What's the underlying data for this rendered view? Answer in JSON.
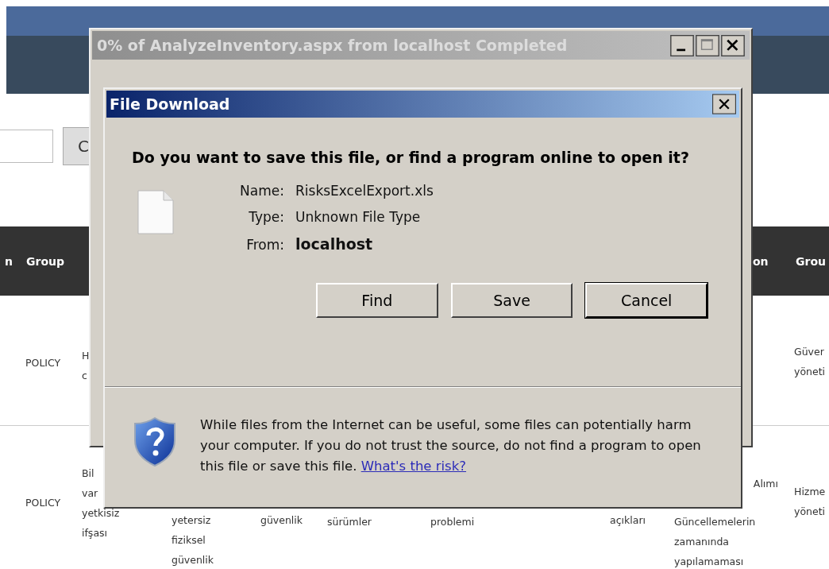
{
  "page": {
    "button": "C"
  },
  "table": {
    "header": {
      "column_1": "n",
      "group": "Group",
      "column_9": "on",
      "column_10": "Grou"
    },
    "rows": [
      {
        "group": "POLICY",
        "column_3": "H\nc",
        "column_10": "Güver\nyöneti"
      },
      {
        "group": "POLICY",
        "column_3": "Bil\nvar\nyetkisiz\nifşası",
        "column_4": "yetersiz\nfiziksel\ngüvenlik",
        "column_5": "güvenlik",
        "column_6": "sürümler",
        "column_7": "problemi",
        "column_8": "açıkları",
        "column_9_fragment": "Alımı",
        "column_9": "Güncellemelerin\nzamanında\nyapılamaması",
        "column_10": "Hizme\nyöneti"
      }
    ]
  },
  "download_window": {
    "title": "0% of AnalyzeInventory.aspx from localhost Completed",
    "active": false
  },
  "dialog": {
    "title": "File Download",
    "active": true,
    "question": "Do you want to save this file, or find a program online to open it?",
    "fields": [
      {
        "label": "Name:",
        "value": "RisksExcelExport.xls",
        "bold": false
      },
      {
        "label": "Type:",
        "value": "Unknown File Type",
        "bold": false
      },
      {
        "label": "From:",
        "value": "localhost",
        "bold": true
      }
    ],
    "buttons": [
      {
        "label": "Find",
        "default": false
      },
      {
        "label": "Save",
        "default": false
      },
      {
        "label": "Cancel",
        "default": true
      }
    ],
    "warning": "While files from the Internet can be useful, some files can potentially harm your computer. If you do not trust the source, do not find a program to open this file or save this file.",
    "link": "What's the risk?"
  }
}
